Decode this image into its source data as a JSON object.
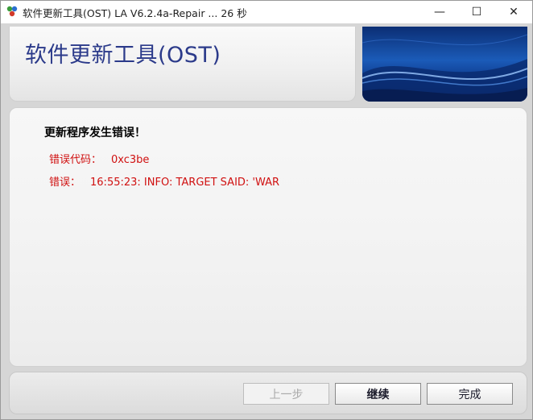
{
  "window": {
    "title": "软件更新工具(OST) LA V6.2.4a-Repair ... 26 秒",
    "minimize_glyph": "—",
    "maximize_glyph": "☐",
    "close_glyph": "✕"
  },
  "header": {
    "title": "软件更新工具(OST)"
  },
  "content": {
    "heading": "更新程序发生错误！",
    "error_code_label": "错误代码：",
    "error_code_value": "0xc3be",
    "error_label": "错误：",
    "error_message": "16:55:23: INFO: TARGET SAID: 'WAR"
  },
  "footer": {
    "prev_label": "上一步",
    "next_label": "继续",
    "done_label": "完成"
  },
  "colors": {
    "header_title": "#2b3a8a",
    "error_text": "#d01010",
    "banner_blue": "#1b5bb8"
  }
}
